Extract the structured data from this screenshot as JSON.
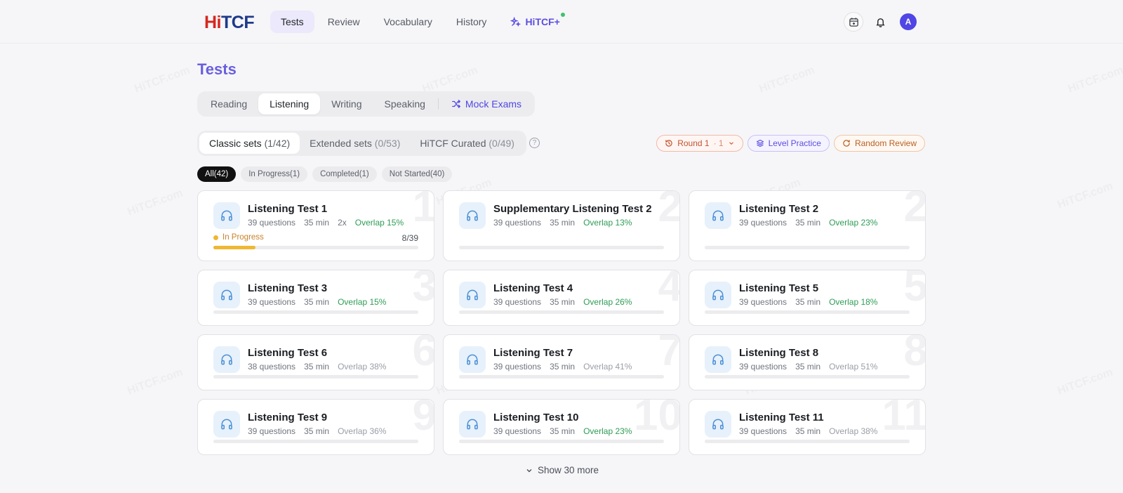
{
  "brand": {
    "logo_hi": "Hi",
    "logo_tcf": "TCF"
  },
  "nav": {
    "items": [
      {
        "label": "Tests",
        "active": true
      },
      {
        "label": "Review",
        "active": false
      },
      {
        "label": "Vocabulary",
        "active": false
      },
      {
        "label": "History",
        "active": false
      }
    ],
    "plus_label": "HiTCF+"
  },
  "user": {
    "avatar_initial": "A"
  },
  "page": {
    "title": "Tests"
  },
  "section_tabs": {
    "items": [
      "Reading",
      "Listening",
      "Writing",
      "Speaking"
    ],
    "active": "Listening",
    "mock_label": "Mock Exams"
  },
  "set_tabs": [
    {
      "label": "Classic sets ",
      "count": "(1/42)",
      "active": true
    },
    {
      "label": "Extended sets ",
      "count": "(0/53)",
      "active": false
    },
    {
      "label": "HiTCF Curated ",
      "count": "(0/49)",
      "active": false
    }
  ],
  "actions": {
    "round_label": "Round 1",
    "round_value": "· 1",
    "level_label": "Level Practice",
    "random_label": "Random Review"
  },
  "filters": [
    {
      "label": "All(42)",
      "active": true
    },
    {
      "label": "In Progress(1)",
      "active": false
    },
    {
      "label": "Completed(1)",
      "active": false
    },
    {
      "label": "Not Started(40)",
      "active": false
    }
  ],
  "tests": [
    {
      "num": "1",
      "name": "Listening Test 1",
      "questions": "39 questions",
      "duration": "35 min",
      "attempts": "2x",
      "overlap": "Overlap 15%",
      "overlap_color": "green",
      "status": "In Progress",
      "progress_text": "8/39",
      "progress": 0.205
    },
    {
      "num": "2",
      "name": "Supplementary Listening Test 2",
      "questions": "39 questions",
      "duration": "35 min",
      "overlap": "Overlap 13%",
      "overlap_color": "green",
      "progress": 0
    },
    {
      "num": "2",
      "name": "Listening Test 2",
      "questions": "39 questions",
      "duration": "35 min",
      "overlap": "Overlap 23%",
      "overlap_color": "green",
      "progress": 0
    },
    {
      "num": "3",
      "name": "Listening Test 3",
      "questions": "39 questions",
      "duration": "35 min",
      "overlap": "Overlap 15%",
      "overlap_color": "green",
      "progress": 0
    },
    {
      "num": "4",
      "name": "Listening Test 4",
      "questions": "39 questions",
      "duration": "35 min",
      "overlap": "Overlap 26%",
      "overlap_color": "green",
      "progress": 0
    },
    {
      "num": "5",
      "name": "Listening Test 5",
      "questions": "39 questions",
      "duration": "35 min",
      "overlap": "Overlap 18%",
      "overlap_color": "green",
      "progress": 0
    },
    {
      "num": "6",
      "name": "Listening Test 6",
      "questions": "38 questions",
      "duration": "35 min",
      "overlap": "Overlap 38%",
      "overlap_color": "gray",
      "progress": 0
    },
    {
      "num": "7",
      "name": "Listening Test 7",
      "questions": "39 questions",
      "duration": "35 min",
      "overlap": "Overlap 41%",
      "overlap_color": "gray",
      "progress": 0
    },
    {
      "num": "8",
      "name": "Listening Test 8",
      "questions": "39 questions",
      "duration": "35 min",
      "overlap": "Overlap 51%",
      "overlap_color": "gray",
      "progress": 0
    },
    {
      "num": "9",
      "name": "Listening Test 9",
      "questions": "39 questions",
      "duration": "35 min",
      "overlap": "Overlap 36%",
      "overlap_color": "gray",
      "progress": 0
    },
    {
      "num": "10",
      "name": "Listening Test 10",
      "questions": "39 questions",
      "duration": "35 min",
      "overlap": "Overlap 23%",
      "overlap_color": "green",
      "progress": 0
    },
    {
      "num": "11",
      "name": "Listening Test 11",
      "questions": "39 questions",
      "duration": "35 min",
      "overlap": "Overlap 38%",
      "overlap_color": "gray",
      "progress": 0
    }
  ],
  "show_more_label": "Show 30 more",
  "watermark_text": "HiTCF.com",
  "colors": {
    "accent": "#5b4ee0",
    "green": "#2e9d55",
    "progress": "#f0b731",
    "brand_red": "#d7261e",
    "brand_blue": "#1e3a8a"
  },
  "icons": [
    "calendar-icon",
    "bell-icon",
    "sparkle-icon",
    "shuffle-icon",
    "help-icon",
    "history-icon",
    "chevron-down-icon",
    "layers-icon",
    "refresh-icon",
    "headphones-icon"
  ]
}
